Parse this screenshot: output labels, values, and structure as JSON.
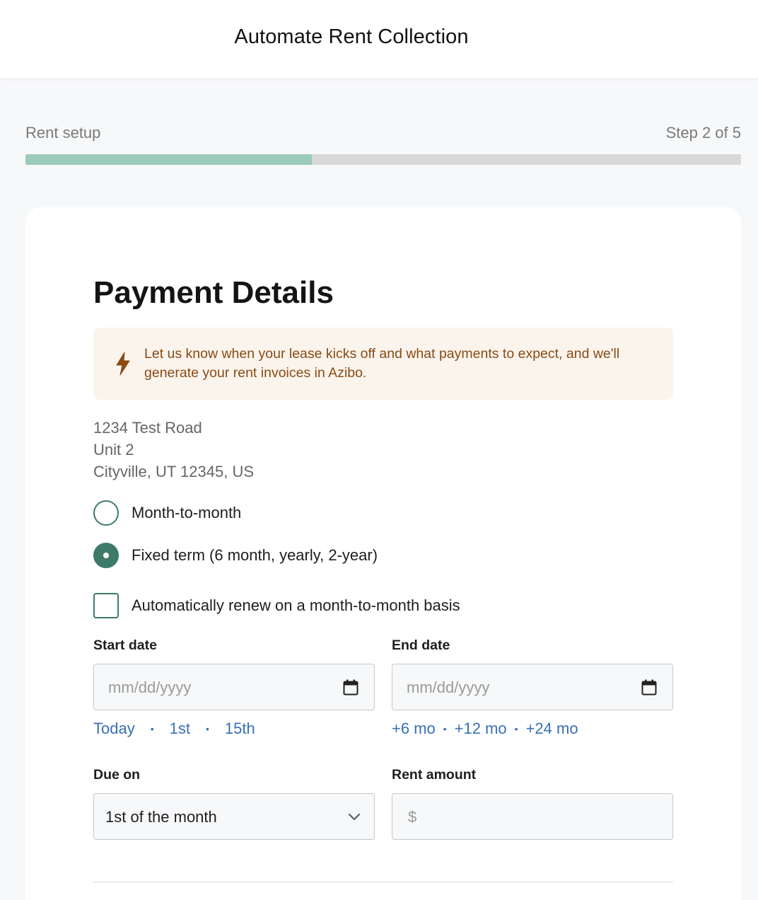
{
  "header": {
    "title": "Automate Rent Collection"
  },
  "progress": {
    "label": "Rent setup",
    "step_text": "Step 2 of 5",
    "fraction": 0.4,
    "fill_color": "#9ccbbc",
    "track_color": "#d9d9d9"
  },
  "form": {
    "title": "Payment Details",
    "banner": {
      "icon": "lightning-bolt-icon",
      "text": "Let us know when your lease kicks off and what payments to expect, and we'll generate your rent invoices in Azibo."
    },
    "address": {
      "line1": "1234 Test Road",
      "line2": "Unit 2",
      "line3": "Cityville, UT 12345, US"
    },
    "lease_type": {
      "options": [
        {
          "label": "Month-to-month",
          "selected": false
        },
        {
          "label": "Fixed term (6 month, yearly, 2-year)",
          "selected": true
        }
      ]
    },
    "auto_renew": {
      "label": "Automatically renew on a month-to-month basis",
      "checked": false
    },
    "start_date": {
      "label": "Start date",
      "placeholder": "mm/dd/yyyy",
      "shortcuts": [
        "Today",
        "1st",
        "15th"
      ]
    },
    "end_date": {
      "label": "End date",
      "placeholder": "mm/dd/yyyy",
      "shortcuts": [
        "+6 mo",
        "+12 mo",
        "+24 mo"
      ]
    },
    "due_on": {
      "label": "Due on",
      "value": "1st of the month"
    },
    "rent_amount": {
      "label": "Rent amount",
      "placeholder": "$"
    }
  },
  "colors": {
    "accent": "#3d7a68",
    "link": "#3a6fb5",
    "banner_bg": "#fbf4ed",
    "banner_text": "#8a4a12"
  }
}
